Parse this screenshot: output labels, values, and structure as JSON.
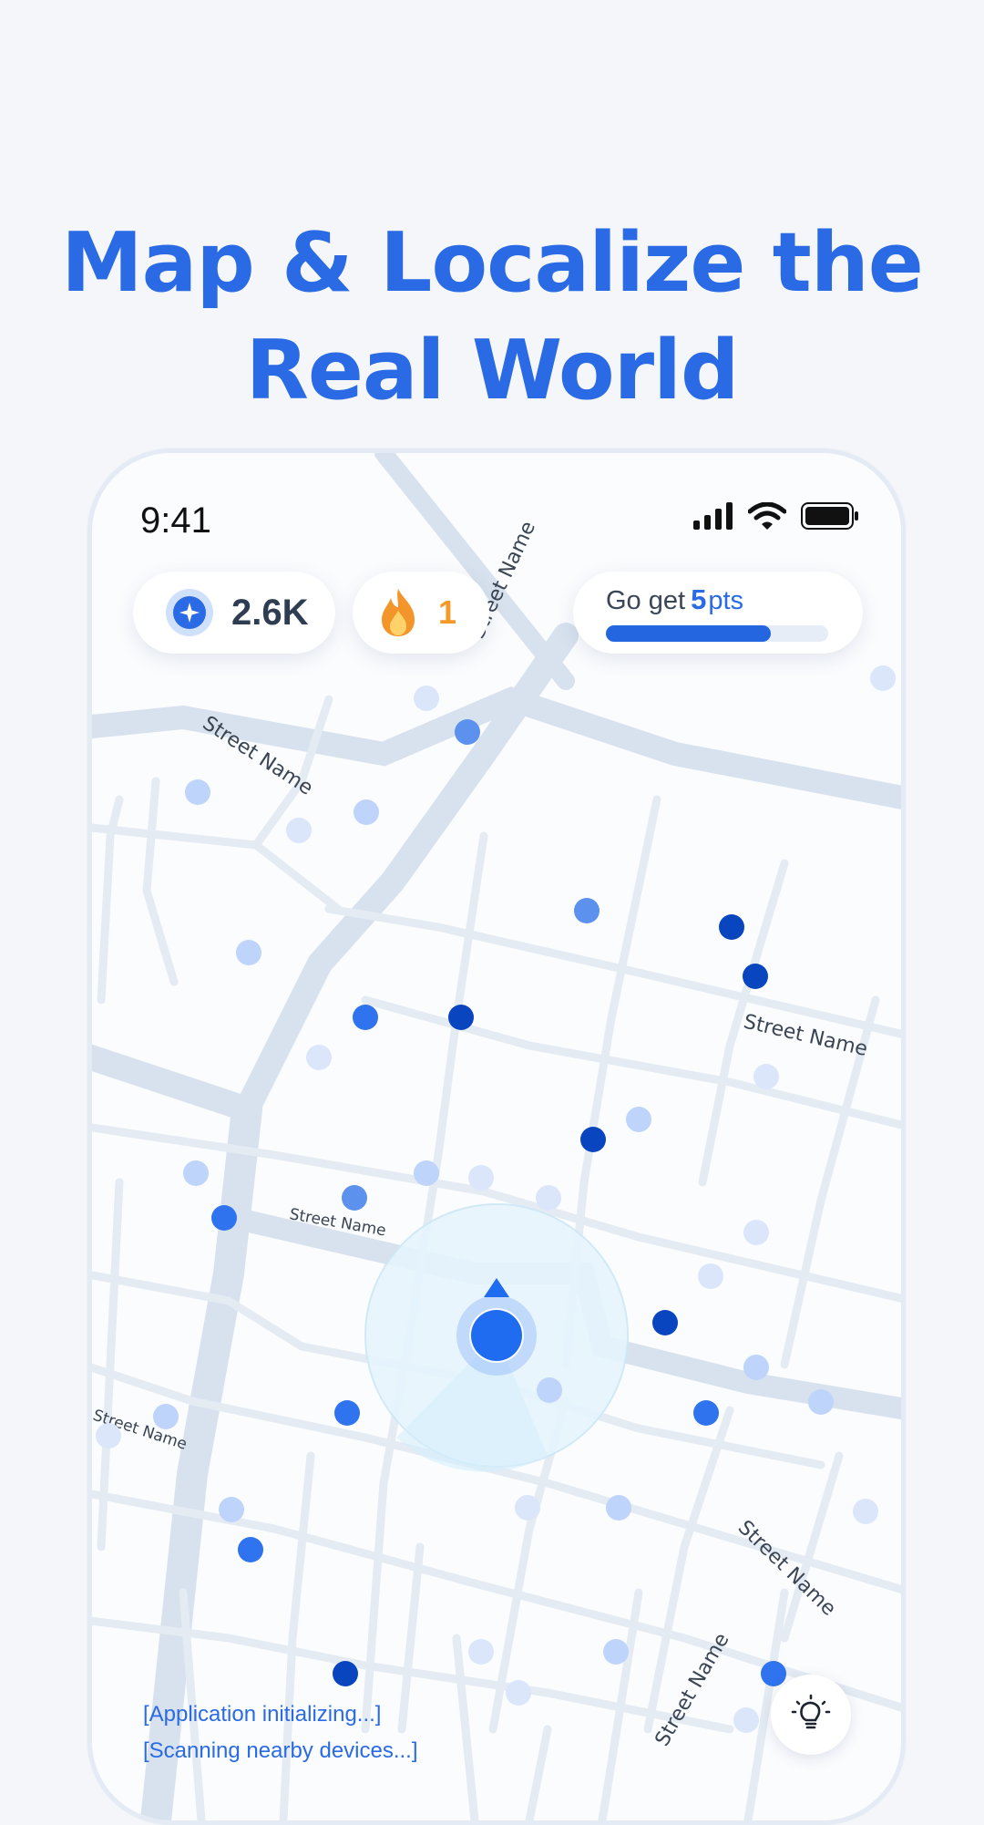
{
  "headline": {
    "line1": "Map & Localize the",
    "line2": "Real World"
  },
  "status_bar": {
    "time": "9:41"
  },
  "stats": {
    "points": "2.6K",
    "streak": "1",
    "goal": {
      "prefix": "Go get",
      "number": "5",
      "unit": "pts",
      "progress": 0.74
    }
  },
  "map": {
    "street_labels": [
      "Street Name",
      "Street Name",
      "Street Name",
      "Street Name",
      "Street Name",
      "Street Name",
      "Street Name"
    ]
  },
  "log": [
    "[Application initializing...]",
    "[Scanning nearby devices...]"
  ],
  "colors": {
    "accent": "#2a6ae4",
    "dot_dark": "#0a45c0",
    "dot_mid": "#2f74ee",
    "dot_light": "#bfd4fa",
    "streak": "#f39a2a",
    "road": "#d8e2ee"
  },
  "icons": {
    "points": "star-badge-icon",
    "streak": "flame-icon",
    "hint": "lightbulb-icon",
    "location": "location-arrow-icon"
  }
}
